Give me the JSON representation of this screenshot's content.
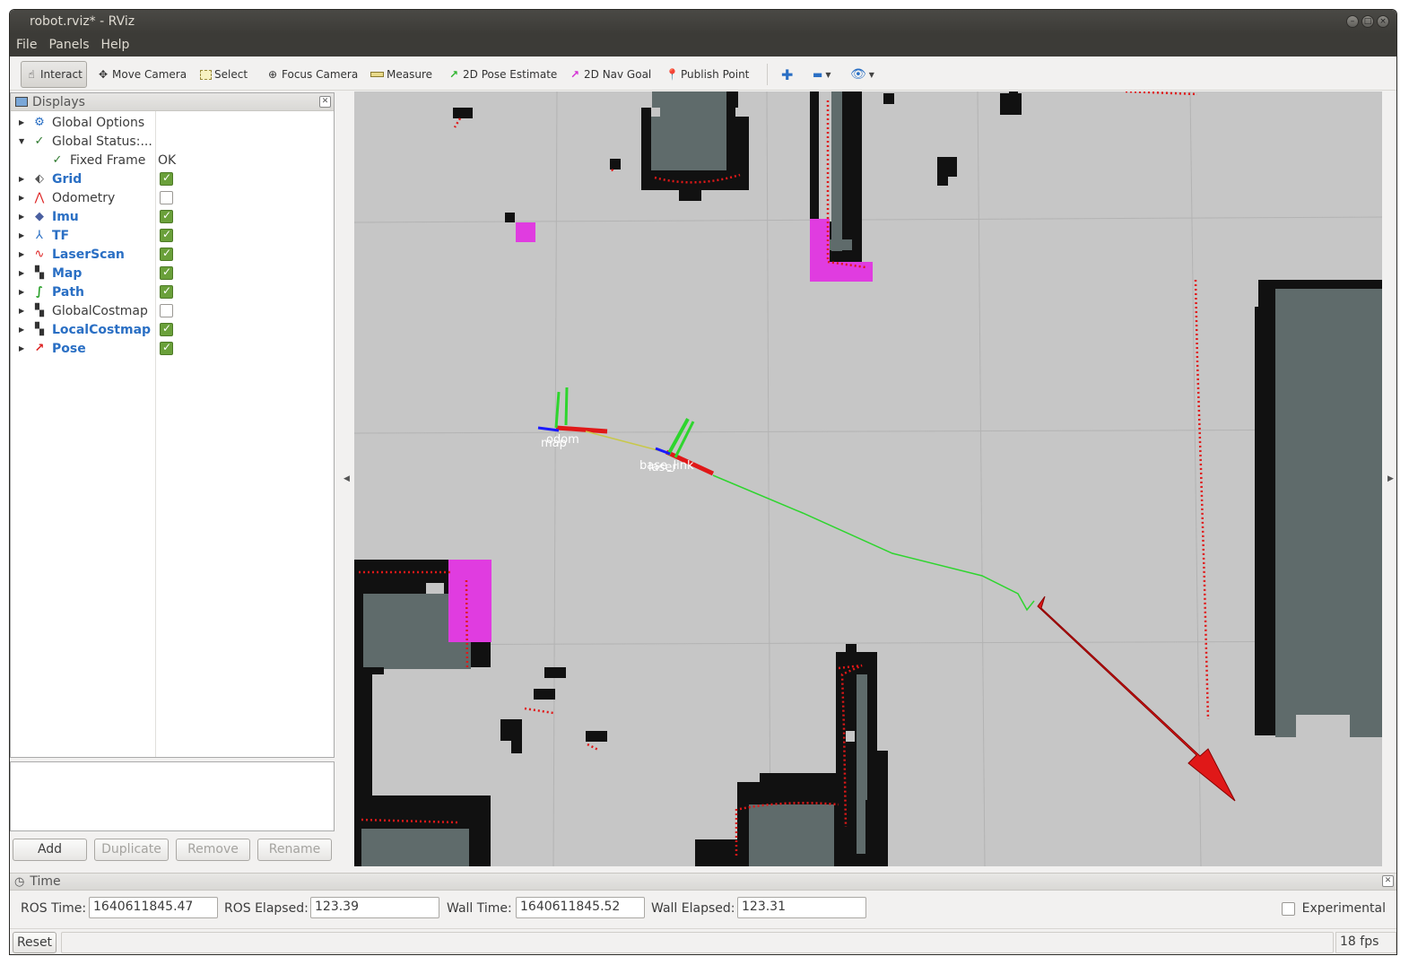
{
  "window": {
    "title": "robot.rviz* - RViz"
  },
  "menu": [
    "File",
    "Panels",
    "Help"
  ],
  "toolbar": {
    "interact": "Interact",
    "move_camera": "Move Camera",
    "select": "Select",
    "focus_camera": "Focus Camera",
    "measure": "Measure",
    "pose_estimate": "2D Pose Estimate",
    "nav_goal": "2D Nav Goal",
    "publish_point": "Publish Point"
  },
  "displays": {
    "title": "Displays",
    "global_options": "Global Options",
    "global_status": "Global Status:...",
    "fixed_frame": "Fixed Frame",
    "fixed_frame_value": "OK",
    "items": [
      {
        "label": "Grid",
        "enabled": true
      },
      {
        "label": "Odometry",
        "enabled": false
      },
      {
        "label": "Imu",
        "enabled": true
      },
      {
        "label": "TF",
        "enabled": true
      },
      {
        "label": "LaserScan",
        "enabled": true
      },
      {
        "label": "Map",
        "enabled": true
      },
      {
        "label": "Path",
        "enabled": true
      },
      {
        "label": "GlobalCostmap",
        "enabled": false
      },
      {
        "label": "LocalCostmap",
        "enabled": true
      },
      {
        "label": "Pose",
        "enabled": true
      }
    ],
    "buttons": {
      "add": "Add",
      "duplicate": "Duplicate",
      "remove": "Remove",
      "rename": "Rename"
    }
  },
  "view": {
    "frame_labels": {
      "map": "map",
      "odom": "odom",
      "base_link": "base_link",
      "laser": "laser"
    }
  },
  "time": {
    "title": "Time",
    "ros_time_label": "ROS Time:",
    "ros_time": "1640611845.47",
    "ros_elapsed_label": "ROS Elapsed:",
    "ros_elapsed": "123.39",
    "wall_time_label": "Wall Time:",
    "wall_time": "1640611845.52",
    "wall_elapsed_label": "Wall Elapsed:",
    "wall_elapsed": "123.31",
    "experimental": "Experimental"
  },
  "status": {
    "reset": "Reset",
    "fps": "18 fps"
  }
}
